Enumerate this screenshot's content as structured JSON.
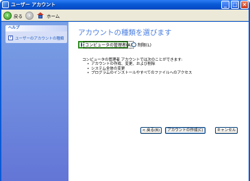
{
  "window": {
    "title": "ユーザー アカウント",
    "controls": {
      "minimize": "_",
      "maximize": "□",
      "close": "×"
    }
  },
  "toolbar": {
    "back_label": "戻る",
    "home_label": "ホーム"
  },
  "sidebar": {
    "help_header": "ヘルプ",
    "help_link": "ユーザーのアカウントの種類"
  },
  "main": {
    "title": "アカウントの種類を選びます",
    "options": [
      {
        "label": "コンピュータの管理者(A)",
        "selected": true
      },
      {
        "label": "制限(L)",
        "selected": false
      }
    ],
    "description": {
      "intro": "コンピュータの管理者 アカウントでは次のことができます:",
      "items": [
        "アカウントの作成、変更、および削除",
        "システム全体の変更",
        "プログラムのインストールやすべてのファイルへのアクセス"
      ]
    },
    "buttons": {
      "back": "< 戻る(B)",
      "create": "アカウントの作成(C)",
      "cancel": "キャンセル"
    }
  },
  "colors": {
    "titlebar": "#0a5ad6",
    "sidebar": "#6f8ee0",
    "title_text": "#4a7ee0",
    "selected_border": "#2e8b1e"
  }
}
